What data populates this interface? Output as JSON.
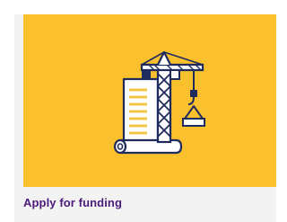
{
  "card": {
    "title": "Apply for funding",
    "illustration": "crane-building-blueprint-icon",
    "colors": {
      "background": "#fbc02d",
      "ink": "#1f2b5c",
      "paper": "#ffffff",
      "paper_lines": "#f4c542",
      "title": "#4b1a7a",
      "card_bg": "#f3f3f3"
    }
  }
}
